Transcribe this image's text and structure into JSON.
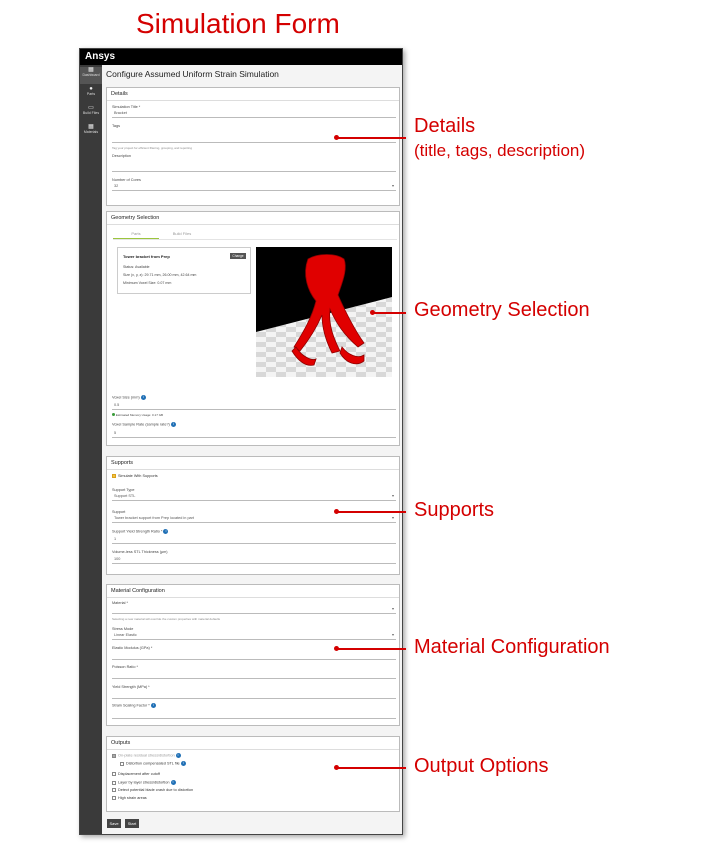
{
  "heading": "Simulation Form",
  "app": {
    "brand": "Ansys"
  },
  "sidebar": {
    "items": [
      {
        "label": "Dashboard",
        "icon": "dashboard-icon"
      },
      {
        "label": "Parts",
        "icon": "parts-icon"
      },
      {
        "label": "Build Files",
        "icon": "folder-icon"
      },
      {
        "label": "Materials",
        "icon": "grid-icon"
      }
    ]
  },
  "page_title": "Configure Assumed Uniform Strain Simulation",
  "details": {
    "title": "Details",
    "sim_title_label": "Simulation Title *",
    "sim_title_value": "Bracket",
    "tags_label": "Tags",
    "tags_hint": "Tag your project for efficient filtering, grouping, and reporting",
    "description_label": "Description",
    "cores_label": "Number of Cores",
    "cores_value": "32"
  },
  "geometry": {
    "title": "Geometry Selection",
    "tab_parts": "Parts",
    "tab_build": "Build Files",
    "part_name": "Tower bracket from Prep",
    "change_label": "Change",
    "status": "Status: Available",
    "size": "Size (x, y, z): 29.71 mm, 26.00 mm, 42.64 mm",
    "min_voxel": "Minimum Voxel Size: 0.07 mm",
    "voxel_label": "Voxel Size (mm)",
    "voxel_value": "0.5",
    "memory_text": "Estimated Memory Usage: 0.17 GB",
    "sample_label": "Voxel Sample Rate (sample rate?)",
    "sample_value": "5"
  },
  "supports": {
    "title": "Supports",
    "simulate_label": "Simulate With Supports",
    "type_label": "Support Type",
    "type_value": "Support STL",
    "support_label": "Support",
    "support_value": "Tower bracket support from Prep located in part",
    "yield_label": "Support Yield Strength Ratio *",
    "yield_value": "1",
    "thickness_label": "Volume-less STL Thickness (µm)",
    "thickness_value": "100"
  },
  "material": {
    "title": "Material Configuration",
    "material_label": "Material *",
    "material_hint": "Selecting a new material will override the custom properties with material defaults",
    "stress_label": "Stress Mode",
    "stress_value": "Linear Elastic",
    "elastic_label": "Elastic Modulus (GPa) *",
    "poisson_label": "Poisson Ratio *",
    "yieldstr_label": "Yield Strength (MPa) *",
    "strain_label": "Strain Scaling Factor *"
  },
  "outputs": {
    "title": "Outputs",
    "items": [
      "On-plate residual stress/distortion",
      "Distortion compensated STL file",
      "Displacement after cutoff",
      "Layer by layer stress/distortion",
      "Detect potential blade crash due to distortion",
      "High strain areas"
    ]
  },
  "buttons": {
    "save": "Save",
    "start": "Start"
  },
  "annotations": {
    "details": "Details",
    "details_sub": "(title, tags, description)",
    "geometry": "Geometry Selection",
    "supports": "Supports",
    "material": "Material Configuration",
    "outputs": "Output Options"
  },
  "colors": {
    "accent": "#d40000",
    "part": "#e00000",
    "tab_underline": "#9bc53d",
    "info": "#1f6fb5"
  }
}
